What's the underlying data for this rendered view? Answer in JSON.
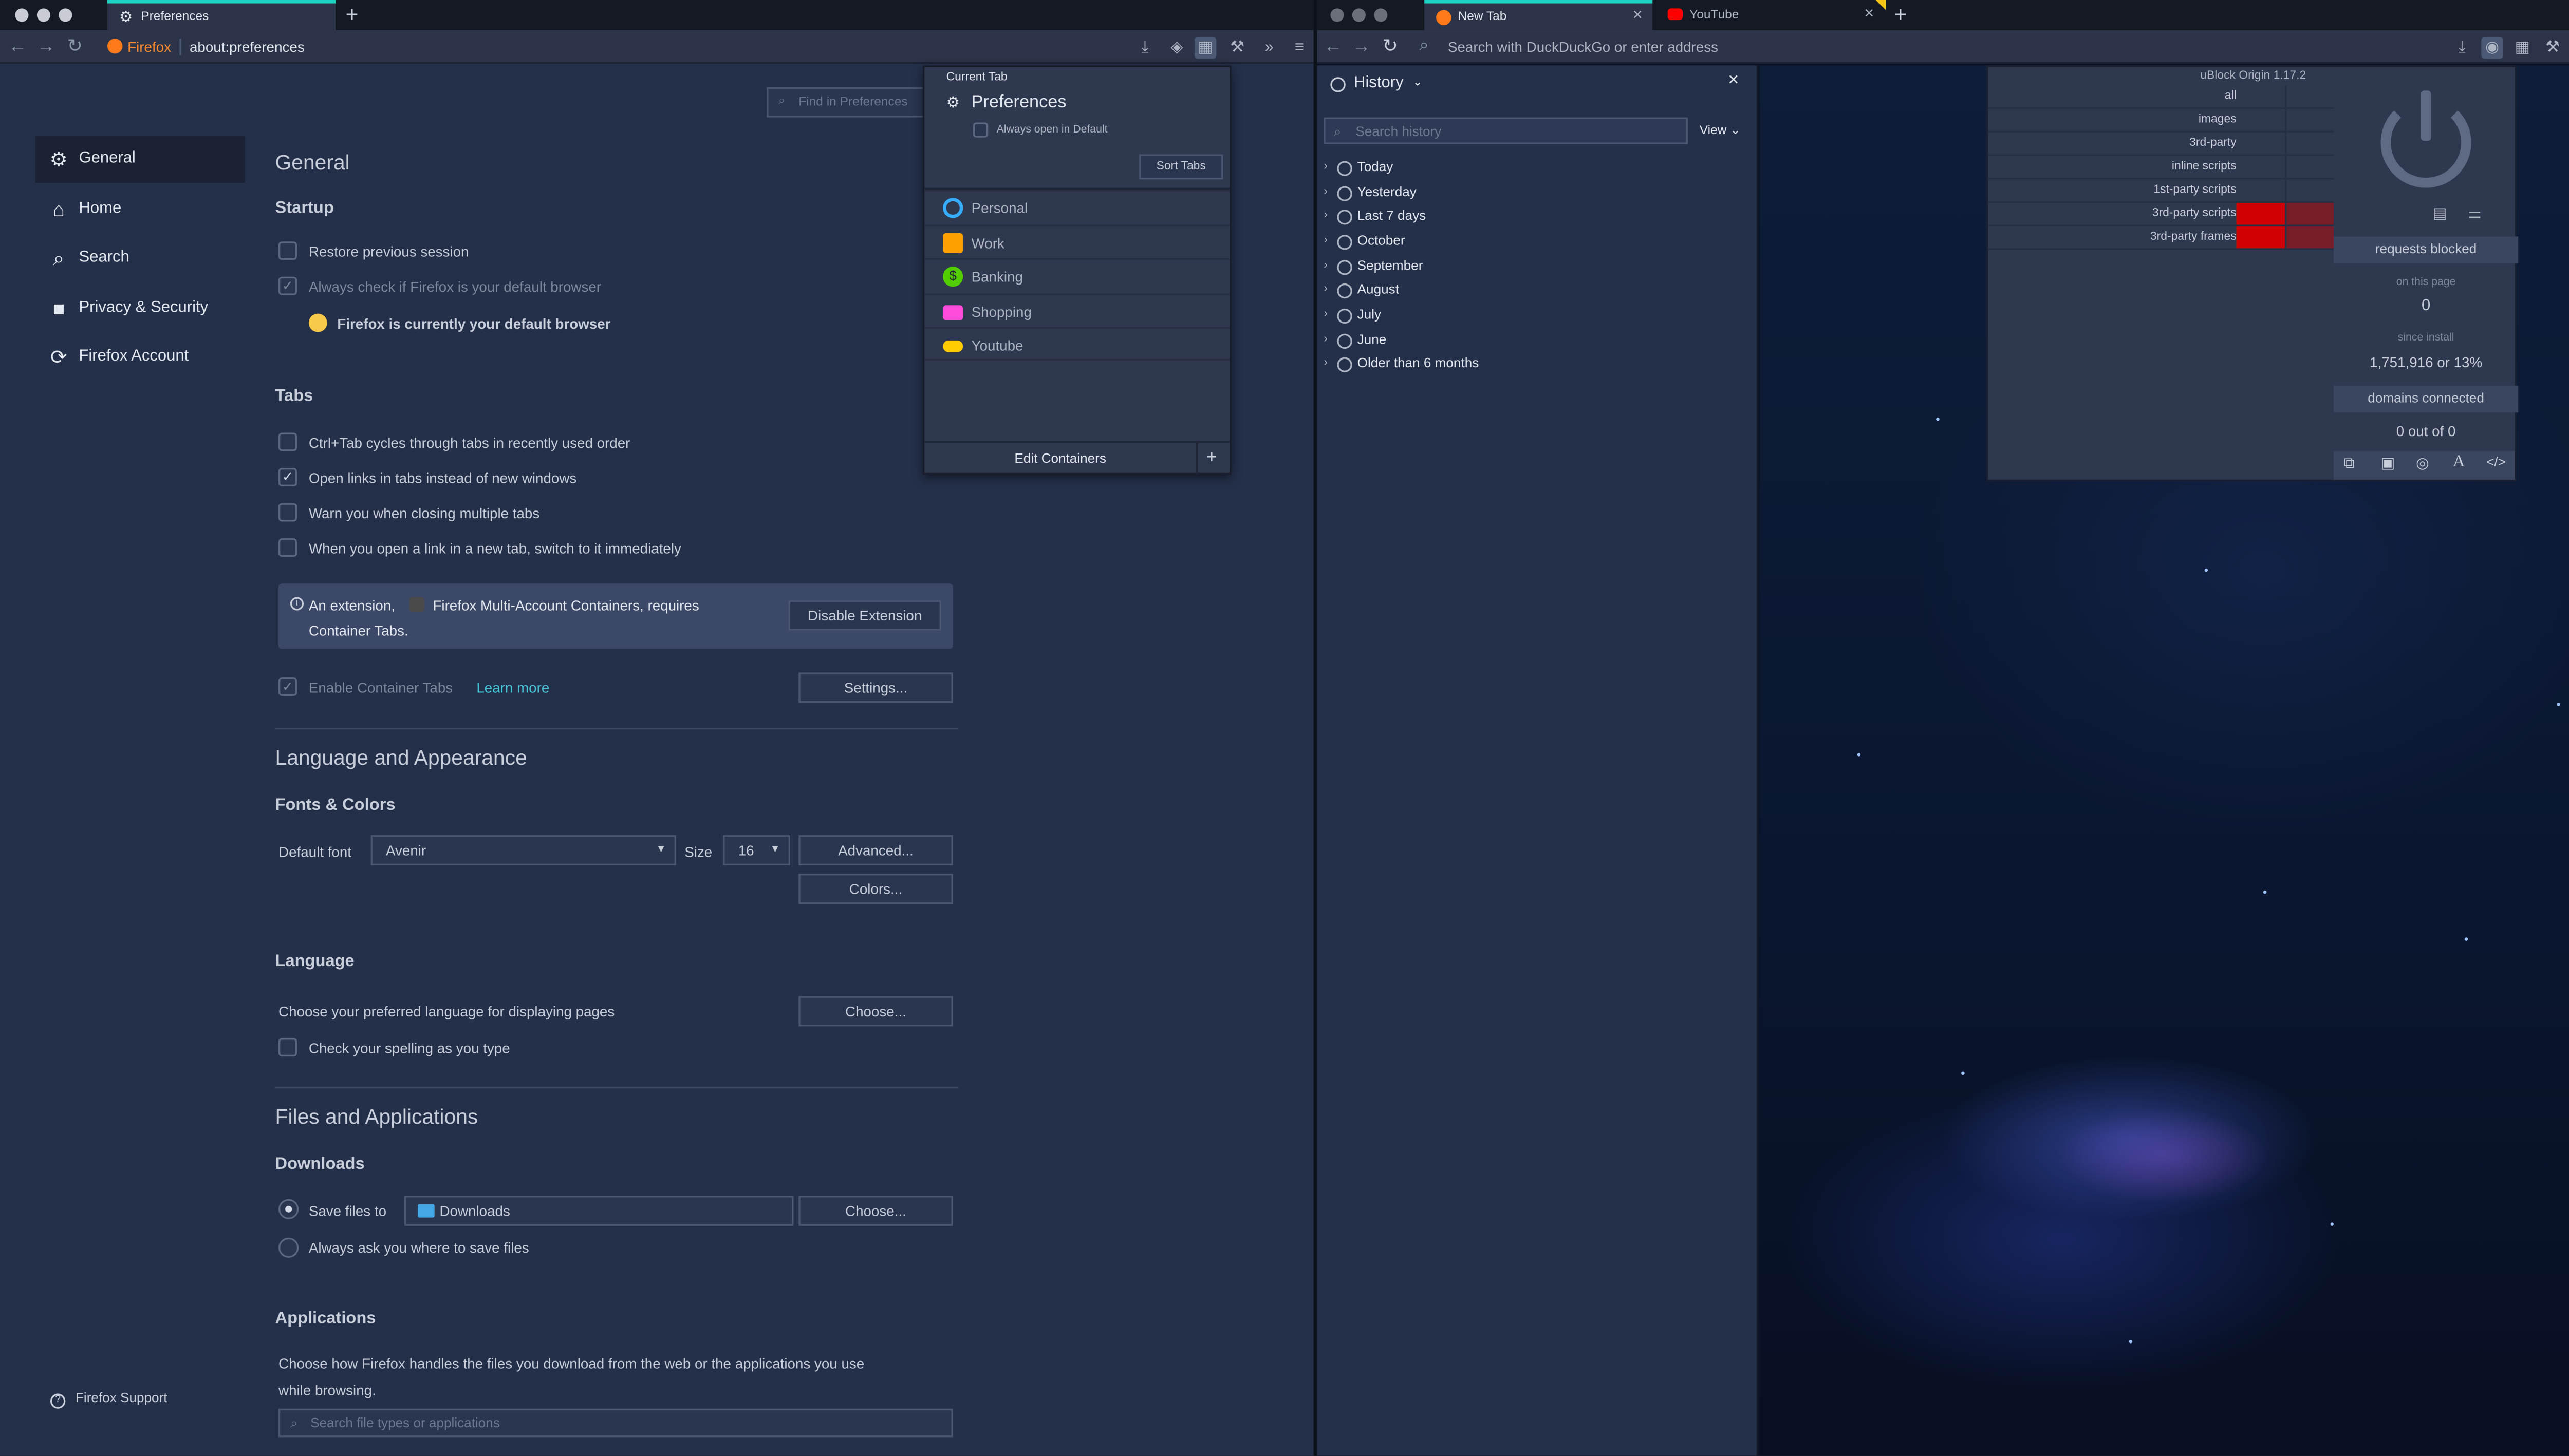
{
  "left_window": {
    "tab_title": "Preferences",
    "url_brand": "Firefox",
    "url": "about:preferences",
    "search_placeholder": "Find in Preferences",
    "sidebar": {
      "items": [
        {
          "label": "General",
          "icon": "gear-icon"
        },
        {
          "label": "Home",
          "icon": "home-icon"
        },
        {
          "label": "Search",
          "icon": "search-icon"
        },
        {
          "label": "Privacy & Security",
          "icon": "lock-icon"
        },
        {
          "label": "Firefox Account",
          "icon": "sync-icon"
        }
      ],
      "support": "Firefox Support"
    },
    "general": {
      "title": "General",
      "startup": {
        "heading": "Startup",
        "restore": "Restore previous session",
        "always_check": "Always check if Firefox is your default browser",
        "default_msg": "Firefox is currently your default browser"
      },
      "tabs": {
        "heading": "Tabs",
        "ctrl_tab": "Ctrl+Tab cycles through tabs in recently used order",
        "open_links": "Open links in tabs instead of new windows",
        "warn_close": "Warn you when closing multiple tabs",
        "switch_new": "When you open a link in a new tab, switch to it immediately",
        "notice_prefix": "An extension,",
        "notice_rest": "Firefox Multi-Account Containers, requires",
        "notice_line2": "Container Tabs.",
        "disable_button": "Disable Extension",
        "enable_container": "Enable Container Tabs",
        "learn_more": "Learn more",
        "settings_button": "Settings..."
      },
      "language_appearance": {
        "title": "Language and Appearance",
        "fonts_heading": "Fonts & Colors",
        "default_font_label": "Default font",
        "default_font": "Avenir",
        "size_label": "Size",
        "size": "16",
        "advanced_button": "Advanced...",
        "colors_button": "Colors...",
        "language_heading": "Language",
        "language_desc": "Choose your preferred language for displaying pages",
        "choose_button": "Choose...",
        "spelling": "Check your spelling as you type"
      },
      "files": {
        "title": "Files and Applications",
        "downloads_heading": "Downloads",
        "save_files": "Save files to",
        "folder": "Downloads",
        "choose_button": "Choose...",
        "always_ask": "Always ask you where to save files",
        "applications_heading": "Applications",
        "applications_desc_1": "Choose how Firefox handles the files you download from the web or the applications you use",
        "applications_desc_2": "while browsing.",
        "search_types_placeholder": "Search file types or applications"
      }
    },
    "containers_popup": {
      "current_tab_label": "Current Tab",
      "current_tab_title": "Preferences",
      "always_open": "Always open in Default",
      "sort_tabs": "Sort Tabs",
      "items": [
        {
          "label": "Personal",
          "icon": "fingerprint-icon",
          "color": "#37adff"
        },
        {
          "label": "Work",
          "icon": "briefcase-icon",
          "color": "#ff9f00"
        },
        {
          "label": "Banking",
          "icon": "dollar-icon",
          "color": "#51cd00"
        },
        {
          "label": "Shopping",
          "icon": "cart-icon",
          "color": "#ff4bda"
        },
        {
          "label": "Youtube",
          "icon": "glasses-icon",
          "color": "#ffcb00"
        }
      ],
      "edit": "Edit Containers",
      "add": "+"
    }
  },
  "right_window": {
    "tabs": [
      {
        "title": "New Tab",
        "icon": "firefox-icon"
      },
      {
        "title": "YouTube",
        "icon": "youtube-icon"
      }
    ],
    "url_placeholder": "Search with DuckDuckGo or enter address",
    "history": {
      "title": "History",
      "search_placeholder": "Search history",
      "view_button": "View",
      "items": [
        "Today",
        "Yesterday",
        "Last 7 days",
        "October",
        "September",
        "August",
        "July",
        "June",
        "Older than 6 months"
      ]
    },
    "ublock": {
      "title": "uBlock Origin 1.17.2",
      "rows": [
        "all",
        "images",
        "3rd-party",
        "inline scripts",
        "1st-party scripts",
        "3rd-party scripts",
        "3rd-party frames"
      ],
      "blocked_rows": [
        false,
        false,
        false,
        false,
        false,
        true,
        true
      ],
      "requests_blocked": "requests blocked",
      "on_this_page": "on this page",
      "on_this_page_value": "0",
      "since_install": "since install",
      "since_install_value": "1,751,916 or 13%",
      "domains_connected": "domains connected",
      "domains_value": "0 out of 0",
      "block_color": "#d10000"
    }
  }
}
